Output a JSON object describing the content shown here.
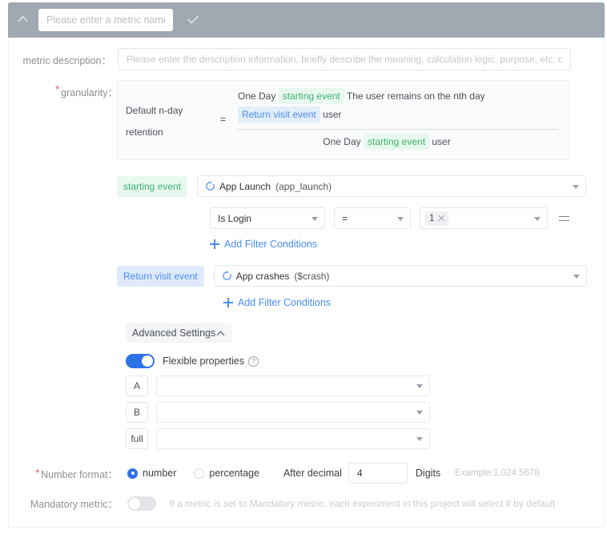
{
  "header": {
    "collapse_icon": "chevron-up-icon",
    "metric_name_value": "",
    "metric_name_placeholder": "Please enter a metric name",
    "confirm_icon": "check-icon"
  },
  "fields": {
    "metric_description": {
      "label": "metric description：",
      "value": "",
      "placeholder": "Please enter the description information, briefly describe the meaning, calculation logic, purpose, etc. of tl"
    },
    "granularity": {
      "label": "granularity：",
      "required": true,
      "formula": {
        "left_title": "Default n-day retention",
        "equals": "=",
        "numerator": {
          "prefix": "One Day",
          "tag1": "starting event",
          "middle": "The user remains on the nth day",
          "tag2": "Return visit event",
          "suffix": "user"
        },
        "denominator": {
          "prefix": "One Day",
          "tag": "starting event",
          "suffix": "user"
        }
      }
    },
    "number_format": {
      "label": "Number format：",
      "required": true,
      "option_number": "number",
      "option_percentage": "percentage",
      "selected": "number",
      "after_decimal_label": "After decimal",
      "decimal_value": "4",
      "digits_label": "Digits",
      "example": "Example:1,024.5678"
    },
    "mandatory_metric": {
      "label": "Mandatory metric：",
      "enabled": false,
      "hint": "If a metric is set to Mandatory metric, each experiment in this project will select it by default"
    }
  },
  "starting_event": {
    "tag": "starting event",
    "event_icon": "cycle-event-icon",
    "event_name": "App Launch",
    "event_key": "(app_launch)",
    "filter": {
      "property": "Is Login",
      "operator": "=",
      "value_tag": "1",
      "remove_icon": "close-icon",
      "swap_icon": "swap-icon"
    },
    "add_filter_label": "Add Filter Conditions"
  },
  "return_visit_event": {
    "tag": "Return visit event",
    "event_icon": "cycle-event-icon",
    "event_name": "App crashes",
    "event_key": "($crash)",
    "add_filter_label": "Add Filter Conditions"
  },
  "advanced_settings": {
    "button_label": "Advanced Settings",
    "chevron_icon": "chevron-up-icon",
    "flexible_properties": {
      "label": "Flexible properties",
      "enabled": true,
      "help_icon": "question-mark-icon",
      "help_glyph": "?"
    },
    "property_rows": [
      {
        "prefix": "A",
        "value": ""
      },
      {
        "prefix": "B",
        "value": ""
      },
      {
        "prefix": "full",
        "value": ""
      }
    ]
  },
  "colors": {
    "header_bg": "#a0a8b1",
    "accent_blue": "#4a8df0",
    "toggle_on": "#2f72e8",
    "tag_green_bg": "#e9f8ef",
    "tag_green_fg": "#3cb371",
    "tag_blue_bg": "#dfeafc",
    "tag_blue_fg": "#4a8df0",
    "required_star": "#f04d4d"
  }
}
